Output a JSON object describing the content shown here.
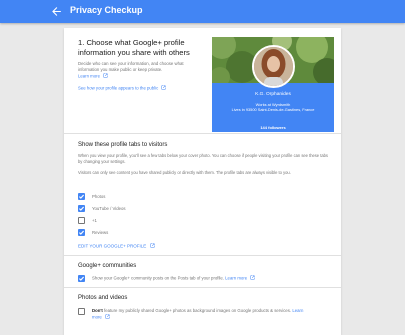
{
  "topbar": {
    "title": "Privacy Checkup",
    "back_icon": "arrow-left-icon",
    "color": "#4285f4"
  },
  "step": {
    "title": "1. Choose what Google+ profile information you share with others",
    "intro": "Decide who can see your information, and choose what information you make public or keep private.",
    "intro_link": "Learn more",
    "preview_link": "See how your profile appears to the public"
  },
  "profile": {
    "name": "K.G. Orphanides",
    "work": "Works at Wyrdsmith",
    "location": "Lives in 93500 Saint-Denis-de-Gastines, France",
    "followers": "144 followers"
  },
  "tabs_section": {
    "title": "Show these profile tabs to visitors",
    "desc1": "When you view your profile, you'll see a few tabs below your cover photo. You can choose if people visiting your profile can see these tabs by changing your settings.",
    "desc2": "Visitors can only see content you have shared publicly or directly with them. The profile tabs are always visible to you.",
    "items": [
      {
        "label": "Photos",
        "checked": true
      },
      {
        "label": "YouTube / Videos",
        "checked": true
      },
      {
        "label": "+1",
        "checked": false
      },
      {
        "label": "Reviews",
        "checked": true
      }
    ],
    "edit_link": "EDIT YOUR GOOGLE+ PROFILE"
  },
  "communities": {
    "title": "Google+ communities",
    "option": "Show your Google+ community posts on the Posts tab of your profile.",
    "learn_more": "Learn more",
    "checked": true
  },
  "photos": {
    "title": "Photos and videos",
    "option_bold": "Don't",
    "option_rest": "feature my publicly shared Google+ photos as background images on Google products & services.",
    "learn_more": "Learn more",
    "checked": false
  }
}
